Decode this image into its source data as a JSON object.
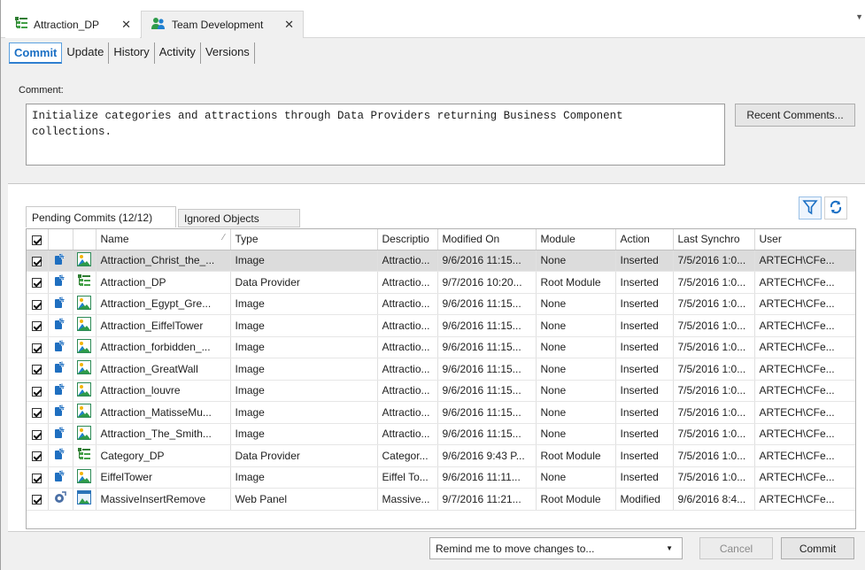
{
  "doc_tabs": [
    {
      "label": "Attraction_DP",
      "icon": "data-provider-icon"
    },
    {
      "label": "Team Development",
      "icon": "team-icon"
    }
  ],
  "sub_tabs": [
    "Commit",
    "Update",
    "History",
    "Activity",
    "Versions"
  ],
  "comment": {
    "label": "Comment:",
    "text": "Initialize categories and attractions through Data Providers returning Business Component\ncollections."
  },
  "recent_comments_label": "Recent Comments...",
  "grid_tabs": [
    "Pending Commits (12/12)",
    "Ignored Objects"
  ],
  "columns": [
    "Name",
    "Type",
    "Descriptio",
    "Modified On",
    "Module",
    "Action",
    "Last Synchro",
    "User"
  ],
  "rows": [
    {
      "name": "Attraction_Christ_the_...",
      "type": "Image",
      "desc": "Attractio...",
      "modified": "9/6/2016 11:15...",
      "module": "None",
      "action": "Inserted",
      "sync": "7/5/2016 1:0...",
      "user": "ARTECH\\CFe...",
      "icon": "image",
      "status": "insert"
    },
    {
      "name": "Attraction_DP",
      "type": "Data Provider",
      "desc": "Attractio...",
      "modified": "9/7/2016 10:20...",
      "module": "Root Module",
      "action": "Inserted",
      "sync": "7/5/2016 1:0...",
      "user": "ARTECH\\CFe...",
      "icon": "dataprovider",
      "status": "insert"
    },
    {
      "name": "Attraction_Egypt_Gre...",
      "type": "Image",
      "desc": "Attractio...",
      "modified": "9/6/2016 11:15...",
      "module": "None",
      "action": "Inserted",
      "sync": "7/5/2016 1:0...",
      "user": "ARTECH\\CFe...",
      "icon": "image",
      "status": "insert"
    },
    {
      "name": "Attraction_EiffelTower",
      "type": "Image",
      "desc": "Attractio...",
      "modified": "9/6/2016 11:15...",
      "module": "None",
      "action": "Inserted",
      "sync": "7/5/2016 1:0...",
      "user": "ARTECH\\CFe...",
      "icon": "image",
      "status": "insert"
    },
    {
      "name": "Attraction_forbidden_...",
      "type": "Image",
      "desc": "Attractio...",
      "modified": "9/6/2016 11:15...",
      "module": "None",
      "action": "Inserted",
      "sync": "7/5/2016 1:0...",
      "user": "ARTECH\\CFe...",
      "icon": "image",
      "status": "insert"
    },
    {
      "name": "Attraction_GreatWall",
      "type": "Image",
      "desc": "Attractio...",
      "modified": "9/6/2016 11:15...",
      "module": "None",
      "action": "Inserted",
      "sync": "7/5/2016 1:0...",
      "user": "ARTECH\\CFe...",
      "icon": "image",
      "status": "insert"
    },
    {
      "name": "Attraction_louvre",
      "type": "Image",
      "desc": "Attractio...",
      "modified": "9/6/2016 11:15...",
      "module": "None",
      "action": "Inserted",
      "sync": "7/5/2016 1:0...",
      "user": "ARTECH\\CFe...",
      "icon": "image",
      "status": "insert"
    },
    {
      "name": "Attraction_MatisseMu...",
      "type": "Image",
      "desc": "Attractio...",
      "modified": "9/6/2016 11:15...",
      "module": "None",
      "action": "Inserted",
      "sync": "7/5/2016 1:0...",
      "user": "ARTECH\\CFe...",
      "icon": "image",
      "status": "insert"
    },
    {
      "name": "Attraction_The_Smith...",
      "type": "Image",
      "desc": "Attractio...",
      "modified": "9/6/2016 11:15...",
      "module": "None",
      "action": "Inserted",
      "sync": "7/5/2016 1:0...",
      "user": "ARTECH\\CFe...",
      "icon": "image",
      "status": "insert"
    },
    {
      "name": "Category_DP",
      "type": "Data Provider",
      "desc": "Categor...",
      "modified": "9/6/2016 9:43 P...",
      "module": "Root Module",
      "action": "Inserted",
      "sync": "7/5/2016 1:0...",
      "user": "ARTECH\\CFe...",
      "icon": "dataprovider",
      "status": "insert"
    },
    {
      "name": "EiffelTower",
      "type": "Image",
      "desc": "Eiffel To...",
      "modified": "9/6/2016 11:11...",
      "module": "None",
      "action": "Inserted",
      "sync": "7/5/2016 1:0...",
      "user": "ARTECH\\CFe...",
      "icon": "image",
      "status": "insert"
    },
    {
      "name": "MassiveInsertRemove",
      "type": "Web Panel",
      "desc": "Massive...",
      "modified": "9/7/2016 11:21...",
      "module": "Root Module",
      "action": "Modified",
      "sync": "9/6/2016 8:4...",
      "user": "ARTECH\\CFe...",
      "icon": "webpanel",
      "status": "modify"
    }
  ],
  "remind_label": "Remind me to move changes to...",
  "cancel_label": "Cancel",
  "commit_label": "Commit",
  "colors": {
    "accent": "#1a6fc4",
    "selected_row": "#dcdcdc"
  }
}
